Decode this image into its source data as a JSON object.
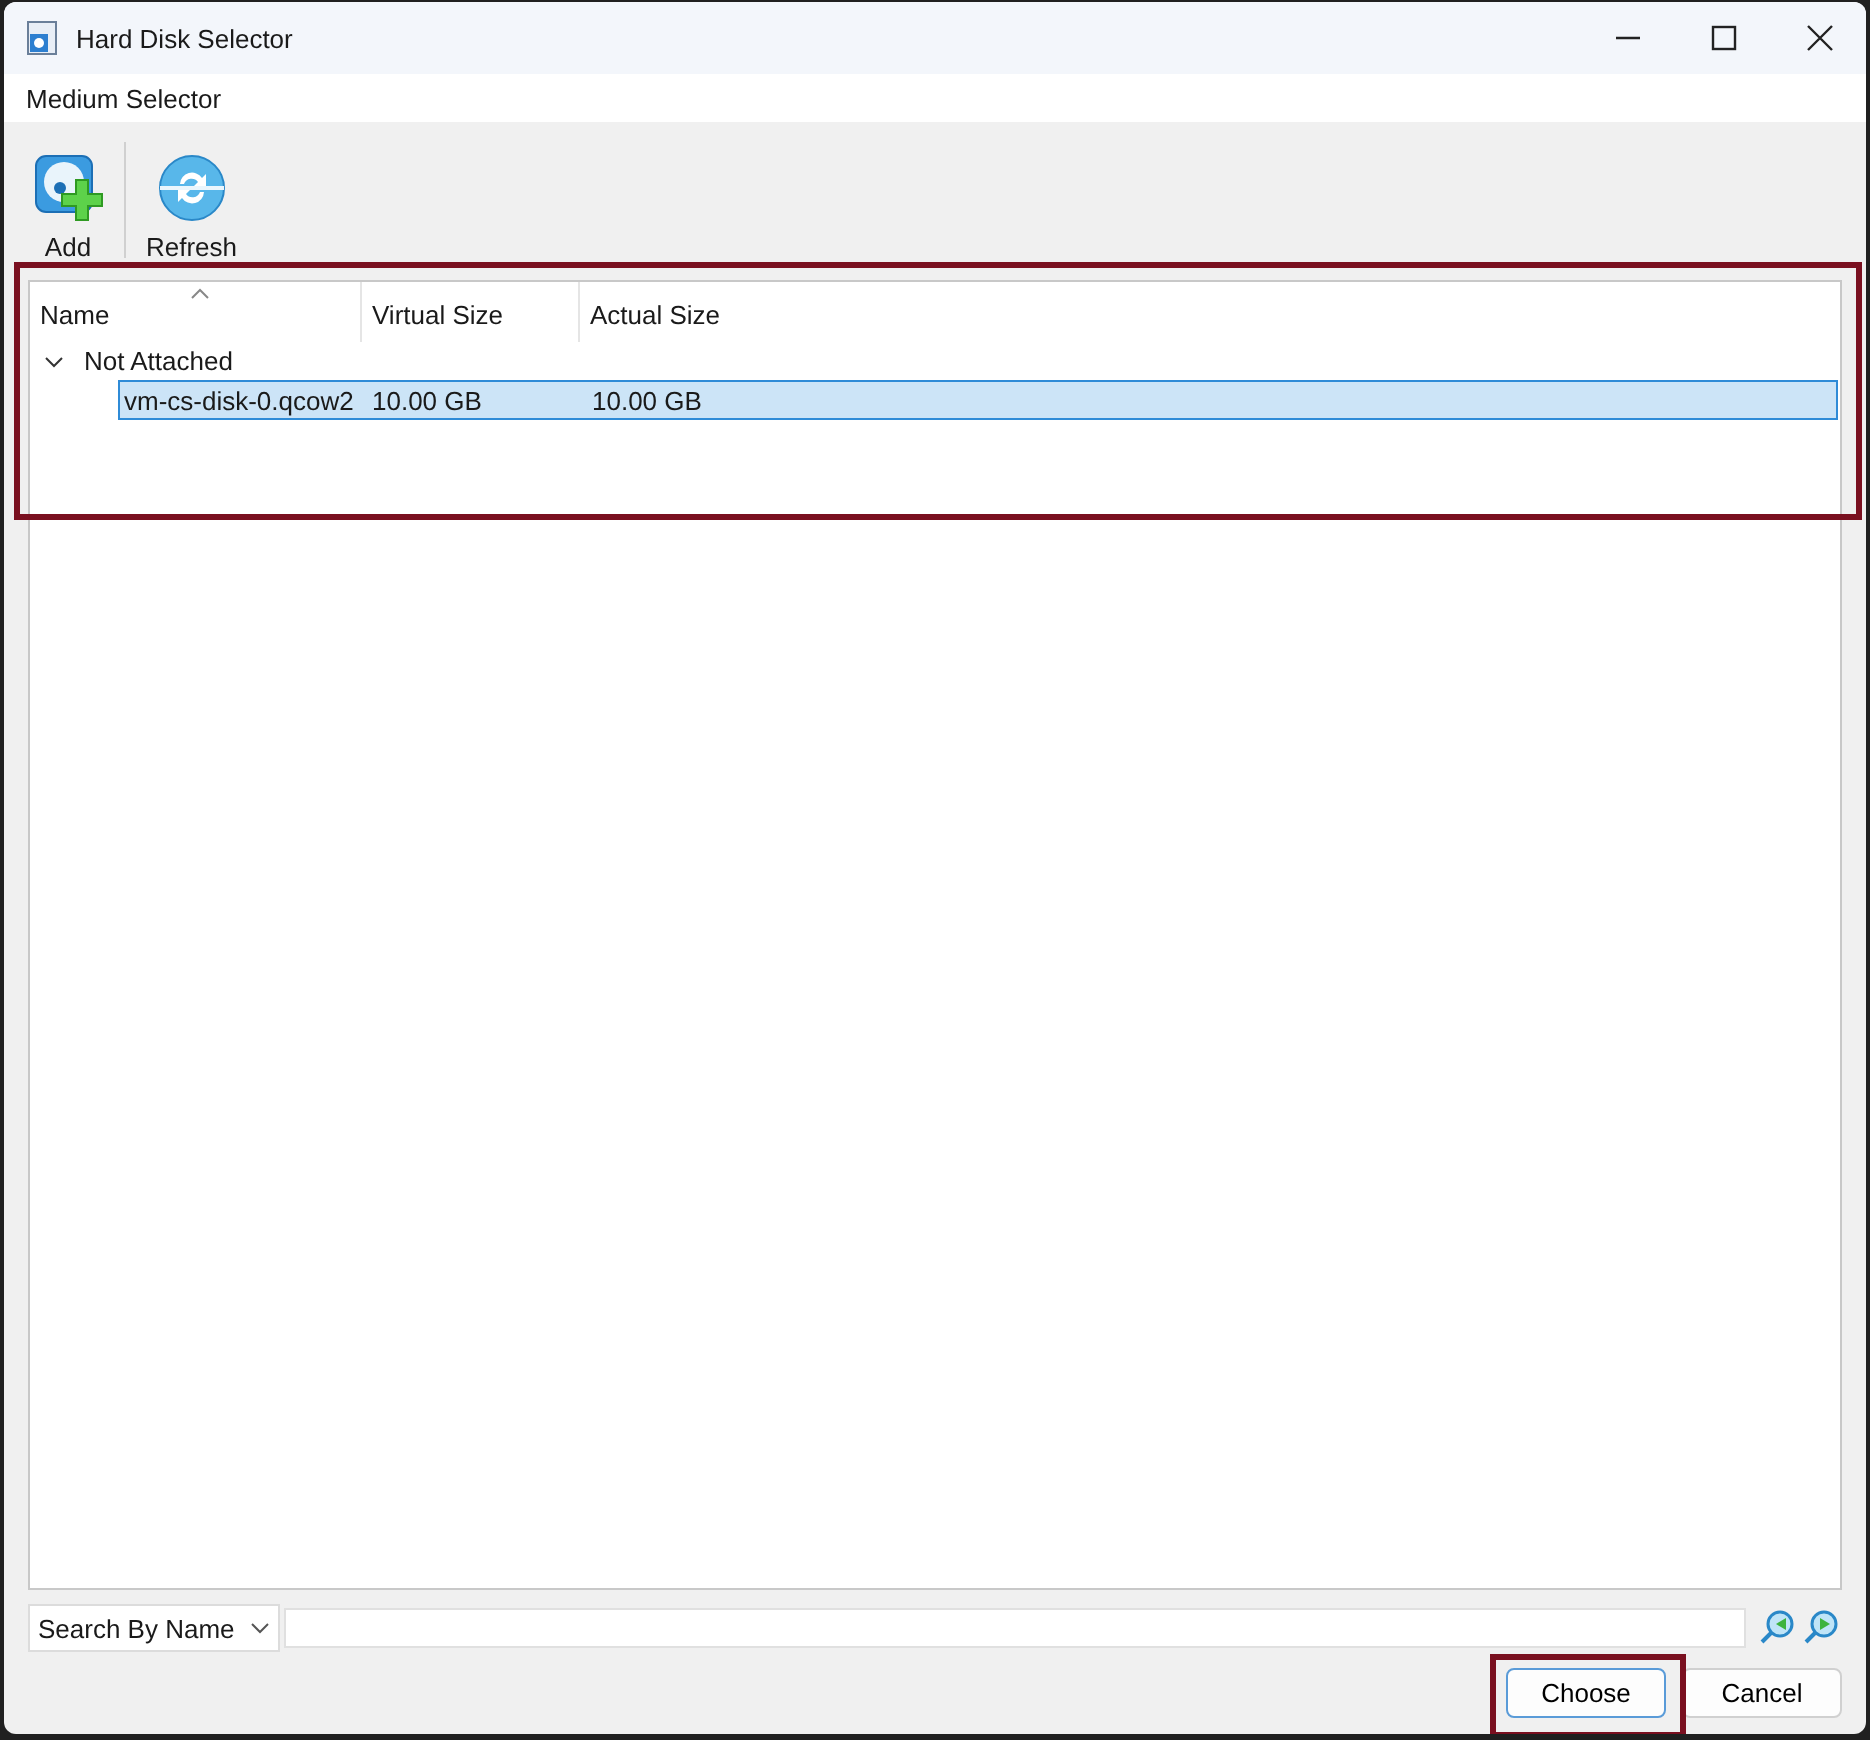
{
  "window": {
    "title": "Hard Disk Selector"
  },
  "header": {
    "title": "Medium Selector"
  },
  "toolbar": [
    {
      "label": "Add",
      "kind": "add"
    },
    {
      "label": "Refresh",
      "kind": "refresh"
    }
  ],
  "table": {
    "columns": [
      "Name",
      "Virtual Size",
      "Actual Size"
    ],
    "rows": [
      {
        "label": "Not Attached",
        "expanded": true,
        "children": [
          {
            "cells": [
              "vm-cs-disk-0.qcow2",
              "10.00 GB",
              "10.00 GB"
            ],
            "selected": true
          }
        ]
      }
    ]
  },
  "search": {
    "mode": "Search By Name"
  },
  "buttons": [
    {
      "label": "Choose",
      "default": true
    },
    {
      "label": "Cancel",
      "default": false
    }
  ]
}
